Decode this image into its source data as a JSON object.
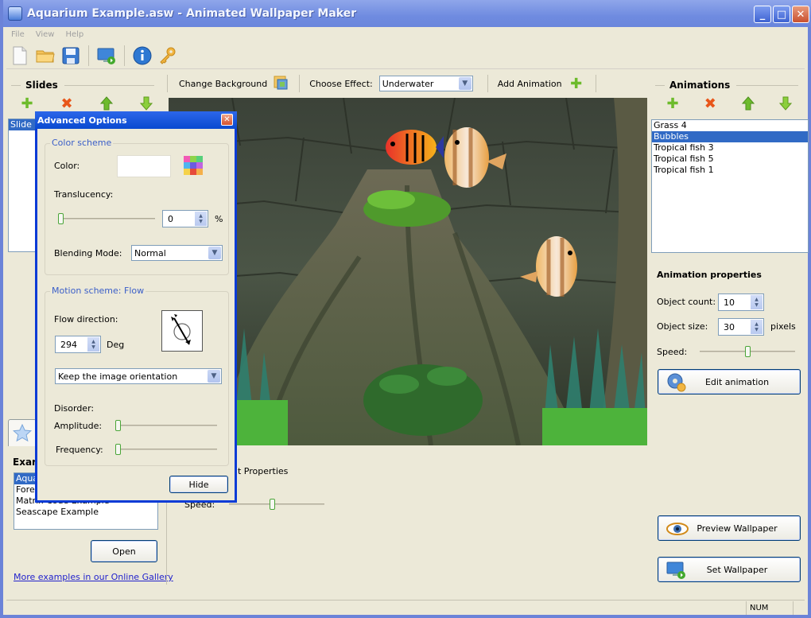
{
  "window": {
    "title": "Aquarium Example.asw - Animated Wallpaper Maker",
    "controls": {
      "minimize": "_",
      "maximize": "□",
      "close": "✕"
    }
  },
  "menu": [
    "File",
    "View",
    "Help"
  ],
  "toolbar": {
    "icons": [
      "new-file-icon",
      "open-folder-icon",
      "save-icon",
      "set-wallpaper-icon",
      "info-icon",
      "key-icon"
    ]
  },
  "slides": {
    "heading": "Slides",
    "items": [
      {
        "label": "Slide 1",
        "selected": true
      }
    ]
  },
  "effects_bar": {
    "change_background_label": "Change Background",
    "choose_effect_label": "Choose Effect:",
    "effect_value": "Underwater",
    "add_animation_label": "Add Animation"
  },
  "animations": {
    "heading": "Animations",
    "items": [
      {
        "label": "Grass 4",
        "selected": false
      },
      {
        "label": "Bubbles",
        "selected": true
      },
      {
        "label": "Tropical fish 3",
        "selected": false
      },
      {
        "label": "Tropical fish 5",
        "selected": false
      },
      {
        "label": "Tropical fish 1",
        "selected": false
      }
    ]
  },
  "animation_properties": {
    "heading": "Animation properties",
    "object_count_label": "Object count:",
    "object_count": "10",
    "object_size_label": "Object size:",
    "object_size": "30",
    "object_size_unit": "pixels",
    "speed_label": "Speed:",
    "speed_fraction": 0.5,
    "edit_button": "Edit animation"
  },
  "effect_properties": {
    "heading_partial": "t Properties",
    "speed_label": "Speed:",
    "speed_fraction": 0.45
  },
  "examples": {
    "heading_partial": "Exar",
    "items": [
      {
        "label": "Aquarium Example",
        "visible": "Aqua",
        "selected": true
      },
      {
        "label": "Forest Example",
        "visible": "Fore",
        "selected": false
      },
      {
        "label": "Matrix Code Example",
        "visible": "Matrix Code Example",
        "selected": false
      },
      {
        "label": "Seascape Example",
        "visible": "Seascape Example",
        "selected": false
      }
    ],
    "open_button": "Open",
    "gallery_link": "More examples in our Online Gallery"
  },
  "actions": {
    "preview_button": "Preview Wallpaper",
    "set_button": "Set Wallpaper"
  },
  "status_bar": {
    "num": "NUM"
  },
  "advanced_dialog": {
    "title": "Advanced Options",
    "color_scheme": {
      "legend": "Color scheme",
      "color_label": "Color:",
      "color_value": "#ffffff",
      "translucency_label": "Translucency:",
      "translucency_value": "0",
      "translucency_unit": "%",
      "translucency_fraction": 0,
      "blending_label": "Blending Mode:",
      "blending_value": "Normal"
    },
    "motion_scheme": {
      "legend": "Motion scheme: Flow",
      "flow_direction_label": "Flow direction:",
      "flow_direction_value": "294",
      "flow_direction_unit": "Deg",
      "orientation_value": "Keep the image orientation",
      "disorder_label": "Disorder:",
      "amplitude_label": "Amplitude:",
      "amplitude_fraction": 0,
      "frequency_label": "Frequency:",
      "frequency_fraction": 0
    },
    "hide_button": "Hide"
  }
}
